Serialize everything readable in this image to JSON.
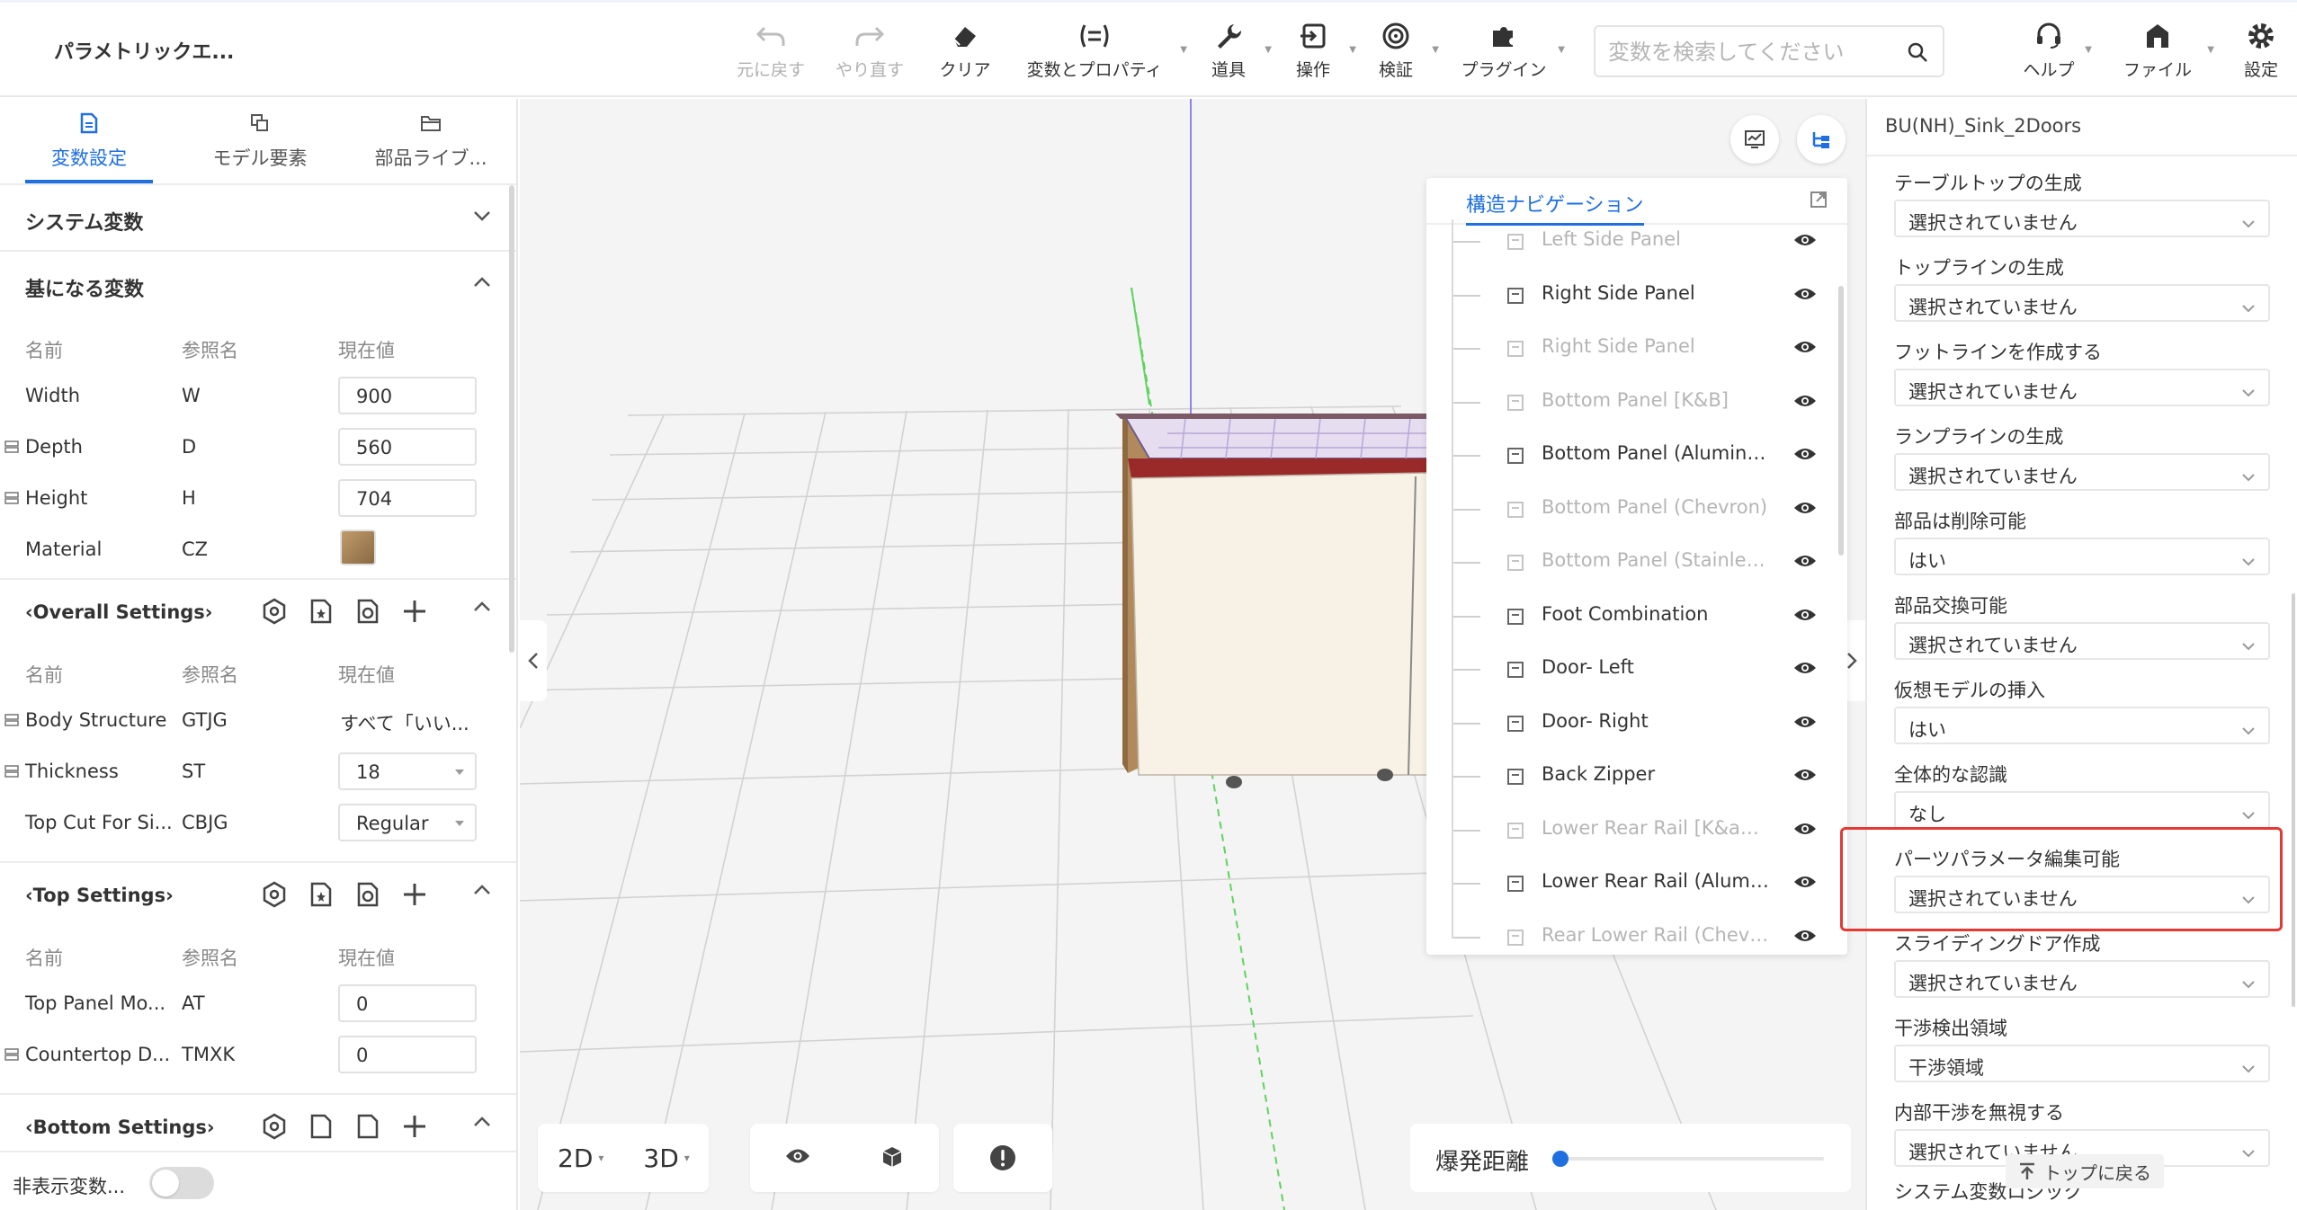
{
  "app": {
    "title": "パラメトリックエ..."
  },
  "toolbar": {
    "undo": "元に戻す",
    "redo": "やり直す",
    "clear": "クリア",
    "vars_props": "変数とプロパティ",
    "tools": "道具",
    "operation": "操作",
    "verify": "検証",
    "plugins": "プラグイン",
    "search_placeholder": "変数を検索してください",
    "help": "ヘルプ",
    "file": "ファイル",
    "settings": "設定"
  },
  "left": {
    "tabs": [
      "変数設定",
      "モデル要素",
      "部品ライブ..."
    ],
    "system_vars": "システム変数",
    "base_vars": "基になる変数",
    "columns": {
      "name": "名前",
      "ref": "参照名",
      "value": "現在値"
    },
    "base_rows": [
      {
        "name": "Width",
        "ref": "W",
        "value": "900"
      },
      {
        "name": "Depth",
        "ref": "D",
        "value": "560"
      },
      {
        "name": "Height",
        "ref": "H",
        "value": "704"
      },
      {
        "name": "Material",
        "ref": "CZ",
        "value": ""
      }
    ],
    "overall": {
      "title": "‹Overall Settings›",
      "rows": [
        {
          "name": "Body Structure",
          "ref": "GTJG",
          "value": "すべて「いい..."
        },
        {
          "name": "Thickness",
          "ref": "ST",
          "value": "18"
        },
        {
          "name": "Top Cut For Si...",
          "ref": "CBJG",
          "value": "Regular"
        }
      ]
    },
    "top": {
      "title": "‹Top Settings›",
      "rows": [
        {
          "name": "Top Panel Mo...",
          "ref": "AT",
          "value": "0"
        },
        {
          "name": "Countertop D...",
          "ref": "TMXK",
          "value": "0"
        }
      ]
    },
    "bottom": {
      "title": "‹Bottom Settings›"
    },
    "hidden_vars": "非表示変数..."
  },
  "viewport": {
    "view_2d": "2D",
    "view_3d": "3D",
    "explode_label": "爆発距離",
    "explode_value": 0
  },
  "nav": {
    "title": "構造ナビゲーション",
    "items": [
      {
        "name": "Left Side Panel",
        "dim": true
      },
      {
        "name": "Right Side Panel",
        "dim": false
      },
      {
        "name": "Right Side Panel",
        "dim": true
      },
      {
        "name": "Bottom Panel [K&B]",
        "dim": true
      },
      {
        "name": "Bottom Panel (Aluminu...",
        "dim": false
      },
      {
        "name": "Bottom Panel (Chevron)",
        "dim": true
      },
      {
        "name": "Bottom Panel (Stainless ...",
        "dim": true
      },
      {
        "name": "Foot Combination",
        "dim": false
      },
      {
        "name": "Door- Left",
        "dim": false
      },
      {
        "name": "Door- Right",
        "dim": false
      },
      {
        "name": "Back Zipper",
        "dim": false
      },
      {
        "name": "Lower Rear Rail [K&amp;...",
        "dim": true
      },
      {
        "name": "Lower Rear Rail (Alumin...",
        "dim": false
      },
      {
        "name": "Rear Lower Rail (Chevron)",
        "dim": true
      }
    ]
  },
  "right": {
    "title": "BU(NH)_Sink_2Doors",
    "props": [
      {
        "label": "テーブルトップの生成",
        "value": "選択されていません"
      },
      {
        "label": "トップラインの生成",
        "value": "選択されていません"
      },
      {
        "label": "フットラインを作成する",
        "value": "選択されていません"
      },
      {
        "label": "ランプラインの生成",
        "value": "選択されていません"
      },
      {
        "label": "部品は削除可能",
        "value": "はい"
      },
      {
        "label": "部品交換可能",
        "value": "選択されていません"
      },
      {
        "label": "仮想モデルの挿入",
        "value": "はい"
      },
      {
        "label": "全体的な認識",
        "value": "なし"
      },
      {
        "label": "パーツパラメータ編集可能",
        "value": "選択されていません"
      },
      {
        "label": "スライディングドア作成",
        "value": "選択されていません"
      },
      {
        "label": "干渉検出領域",
        "value": "干渉領域"
      },
      {
        "label": "内部干渉を無視する",
        "value": "選択されていません"
      }
    ],
    "last_label": "システム変数ロジック",
    "back_to_top": "トップに戻る"
  },
  "colors": {
    "accent": "#1f6fe0",
    "highlight": "#e53935"
  }
}
